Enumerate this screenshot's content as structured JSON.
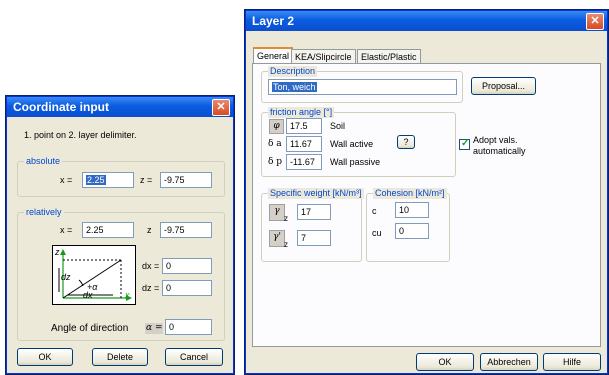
{
  "coord_dialog": {
    "title": "Coordinate input",
    "instruction": "1. point on 2. layer delimiter.",
    "absolute_group": "absolute",
    "x_label": "x =",
    "x_value": "2.25",
    "z_label": "z =",
    "z_value": "-9.75",
    "relatively_group": "relatively",
    "rx_label": "x =",
    "rx_value": "2.25",
    "rz_label": "z",
    "rz_value": "-9.75",
    "dx_label": "dx =",
    "dx_value": "0",
    "dz_label": "dz =",
    "dz_value": "0",
    "angle_label": "Angle of direction",
    "angle_symbol": "α =",
    "angle_value": "0",
    "ok_label": "OK",
    "delete_label": "Delete",
    "cancel_label": "Cancel",
    "diagram": {
      "z": "z",
      "dz": "dz",
      "dx": "dx",
      "x": "x",
      "alpha": "+α"
    }
  },
  "layer_dialog": {
    "title": "Layer  2",
    "tabs": [
      "General",
      "KEA/Slipcircle",
      "Elastic/Plastic"
    ],
    "description_group": "Description",
    "description_value": "Ton, weich",
    "proposal_label": "Proposal...",
    "friction_group": "friction angle [°]",
    "phi_symbol": "φ",
    "phi_value": "17.5",
    "phi_label": "Soil",
    "da_symbol": "δ a",
    "da_value": "11.67",
    "da_label": "Wall active",
    "help_mark": "?",
    "dp_symbol": "δ p",
    "dp_value": "-11.67",
    "dp_label": "Wall passive",
    "adopt_label": "Adopt vals. automatically",
    "weight_group": "Specific weight [kN/m³]",
    "gz_symbol": "γ",
    "gz_sub": "z",
    "gz_value": "17",
    "gz2_symbol": "γ'",
    "gz2_sub": "z",
    "gz2_value": "7",
    "cohesion_group": "Cohesion [kN/m²]",
    "c_label": "c",
    "c_value": "10",
    "cu_label": "cu",
    "cu_value": "0",
    "ok_label": "OK",
    "cancel_label": "Abbrechen",
    "help_label": "Hilfe"
  },
  "colors": {
    "title_blue": "#0b5ce0",
    "group_label": "#0046d5",
    "selection": "#316ac5"
  },
  "icons": [
    "close-icon",
    "help-icon",
    "check-icon"
  ]
}
